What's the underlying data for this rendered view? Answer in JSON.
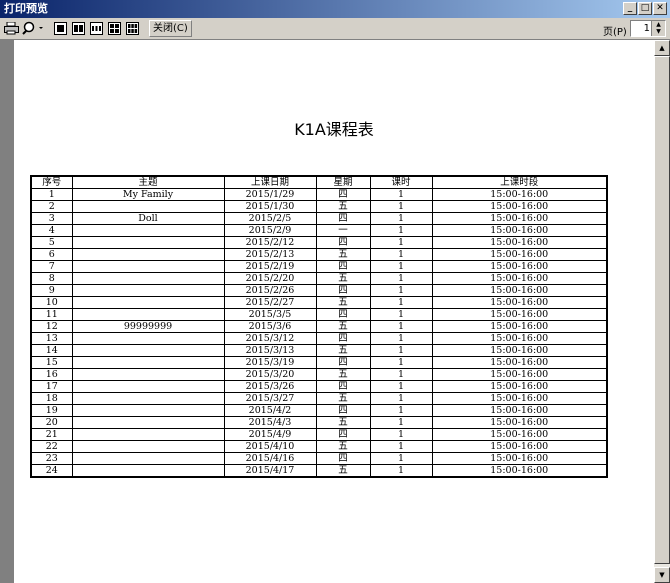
{
  "window": {
    "title": "打印预览",
    "min": "_",
    "max": "□",
    "close": "✕"
  },
  "toolbar": {
    "print_icon": "printer-icon",
    "zoom_icon": "magnifier-icon",
    "close_label": "关闭(C)",
    "page_label": "页(P)",
    "page_value": "1"
  },
  "report": {
    "title": "K1A课程表",
    "headers": [
      "序号",
      "主题",
      "上课日期",
      "星期",
      "课时",
      "上课时段"
    ],
    "rows": [
      [
        "1",
        "My Family",
        "2015/1/29",
        "四",
        "1",
        "15:00-16:00"
      ],
      [
        "2",
        "",
        "2015/1/30",
        "五",
        "1",
        "15:00-16:00"
      ],
      [
        "3",
        "Doll",
        "2015/2/5",
        "四",
        "1",
        "15:00-16:00"
      ],
      [
        "4",
        "",
        "2015/2/9",
        "一",
        "1",
        "15:00-16:00"
      ],
      [
        "5",
        "",
        "2015/2/12",
        "四",
        "1",
        "15:00-16:00"
      ],
      [
        "6",
        "",
        "2015/2/13",
        "五",
        "1",
        "15:00-16:00"
      ],
      [
        "7",
        "",
        "2015/2/19",
        "四",
        "1",
        "15:00-16:00"
      ],
      [
        "8",
        "",
        "2015/2/20",
        "五",
        "1",
        "15:00-16:00"
      ],
      [
        "9",
        "",
        "2015/2/26",
        "四",
        "1",
        "15:00-16:00"
      ],
      [
        "10",
        "",
        "2015/2/27",
        "五",
        "1",
        "15:00-16:00"
      ],
      [
        "11",
        "",
        "2015/3/5",
        "四",
        "1",
        "15:00-16:00"
      ],
      [
        "12",
        "99999999",
        "2015/3/6",
        "五",
        "1",
        "15:00-16:00"
      ],
      [
        "13",
        "",
        "2015/3/12",
        "四",
        "1",
        "15:00-16:00"
      ],
      [
        "14",
        "",
        "2015/3/13",
        "五",
        "1",
        "15:00-16:00"
      ],
      [
        "15",
        "",
        "2015/3/19",
        "四",
        "1",
        "15:00-16:00"
      ],
      [
        "16",
        "",
        "2015/3/20",
        "五",
        "1",
        "15:00-16:00"
      ],
      [
        "17",
        "",
        "2015/3/26",
        "四",
        "1",
        "15:00-16:00"
      ],
      [
        "18",
        "",
        "2015/3/27",
        "五",
        "1",
        "15:00-16:00"
      ],
      [
        "19",
        "",
        "2015/4/2",
        "四",
        "1",
        "15:00-16:00"
      ],
      [
        "20",
        "",
        "2015/4/3",
        "五",
        "1",
        "15:00-16:00"
      ],
      [
        "21",
        "",
        "2015/4/9",
        "四",
        "1",
        "15:00-16:00"
      ],
      [
        "22",
        "",
        "2015/4/10",
        "五",
        "1",
        "15:00-16:00"
      ],
      [
        "23",
        "",
        "2015/4/16",
        "四",
        "1",
        "15:00-16:00"
      ],
      [
        "24",
        "",
        "2015/4/17",
        "五",
        "1",
        "15:00-16:00"
      ]
    ]
  }
}
